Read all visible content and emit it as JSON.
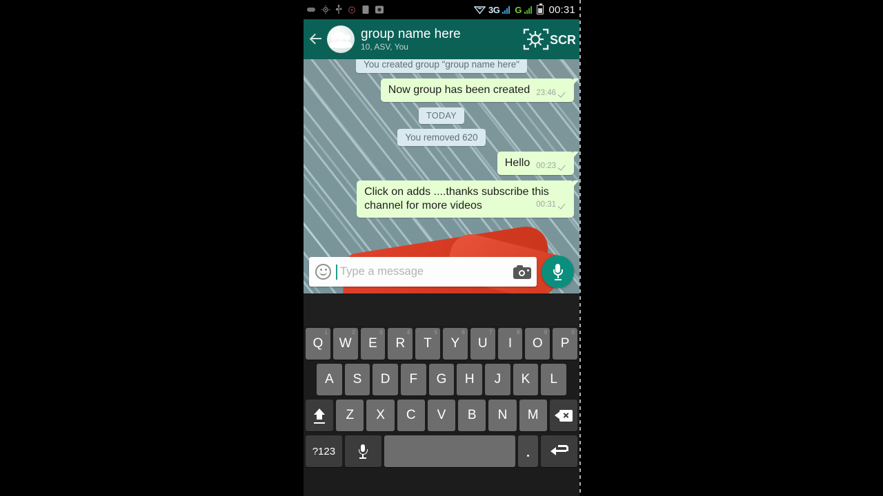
{
  "status_bar": {
    "icons": [
      "sim-icon",
      "settings-sync-icon",
      "usb-icon",
      "alarm-icon",
      "sd-card-icon",
      "screenshot-icon"
    ],
    "network_type": "3G",
    "carrier_g": "G",
    "wifi": "wifi-icon",
    "battery": "battery-icon",
    "clock": "00:31"
  },
  "header": {
    "back": "back-arrow-icon",
    "avatar": "group-avatar-icon",
    "title": "group name here",
    "subtitle": "10, ASV, You",
    "watermark": "SCR"
  },
  "conversation": {
    "messages": [
      {
        "kind": "system",
        "text": "You created group \"group name here\"",
        "clipped": true
      },
      {
        "kind": "outgoing",
        "text": "Now group has been created",
        "time": "23:46",
        "status": "sent"
      },
      {
        "kind": "divider",
        "text": "TODAY"
      },
      {
        "kind": "system",
        "text": "You removed 620"
      },
      {
        "kind": "outgoing",
        "text": "Hello",
        "time": "00:23",
        "status": "sent"
      },
      {
        "kind": "outgoing",
        "text": "Click on adds ....thanks subscribe this channel for more videos",
        "time": "00:31",
        "status": "sent",
        "multiline": true
      }
    ]
  },
  "input_bar": {
    "emoji": "emoji-icon",
    "placeholder": "Type a message",
    "value": "",
    "camera": "camera-icon",
    "mic": "microphone-icon"
  },
  "keyboard": {
    "row1": [
      {
        "key": "Q",
        "hint": "1"
      },
      {
        "key": "W",
        "hint": "2"
      },
      {
        "key": "E",
        "hint": "3"
      },
      {
        "key": "R",
        "hint": "4"
      },
      {
        "key": "T",
        "hint": "5"
      },
      {
        "key": "Y",
        "hint": "6"
      },
      {
        "key": "U",
        "hint": "7"
      },
      {
        "key": "I",
        "hint": "8"
      },
      {
        "key": "O",
        "hint": "9"
      },
      {
        "key": "P",
        "hint": "0"
      }
    ],
    "row2": [
      {
        "key": "A",
        "hint": ""
      },
      {
        "key": "S",
        "hint": ""
      },
      {
        "key": "D",
        "hint": ""
      },
      {
        "key": "F",
        "hint": ""
      },
      {
        "key": "G",
        "hint": ""
      },
      {
        "key": "H",
        "hint": ""
      },
      {
        "key": "J",
        "hint": ""
      },
      {
        "key": "K",
        "hint": ""
      },
      {
        "key": "L",
        "hint": ""
      }
    ],
    "row3": [
      {
        "key": "Z",
        "hint": ""
      },
      {
        "key": "X",
        "hint": ""
      },
      {
        "key": "C",
        "hint": ""
      },
      {
        "key": "V",
        "hint": ""
      },
      {
        "key": "B",
        "hint": ""
      },
      {
        "key": "N",
        "hint": ""
      },
      {
        "key": "M",
        "hint": ""
      }
    ],
    "shift": "shift-icon",
    "backspace": "backspace-icon",
    "symbols": "?123",
    "mic": "microphone-icon",
    "space": "",
    "period": ".",
    "enter": "enter-icon"
  },
  "colors": {
    "header_green": "#0c6157",
    "outgoing_bubble": "#e6ffd2",
    "system_bubble": "#dae9ef",
    "mic_button": "#0b8f7d",
    "wallpaper": "#7b969b",
    "key_face": "#6d6d6d"
  }
}
